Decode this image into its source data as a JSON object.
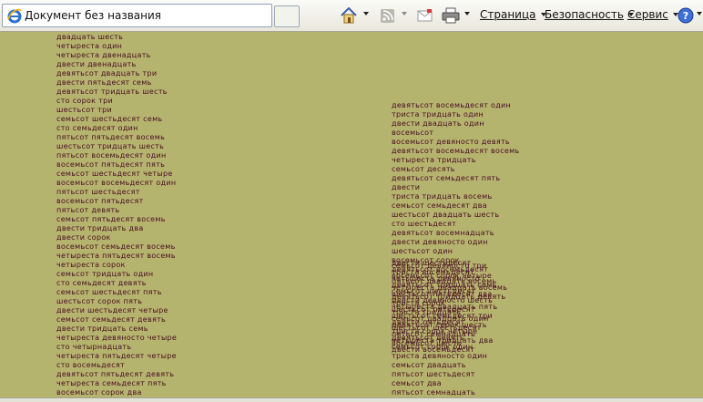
{
  "tab": {
    "title": "Документ без названия"
  },
  "toolbar": {
    "menus": [
      "Страница",
      "Безопасность",
      "Сервис"
    ],
    "icons": [
      "home-icon",
      "feeds-icon",
      "read-mail-icon",
      "print-icon",
      "help-icon"
    ]
  },
  "content": {
    "col1": [
      "двадцать шесть",
      "четыреста один",
      "четыреста двенадцать",
      "двести двенадцать",
      "девятьсот двадцать три",
      "двести пятьдесят семь",
      "девятьсот тридцать шесть",
      "сто сорок три",
      "шестьсот три",
      "семьсот шестьдесят семь",
      "сто семьдесят один",
      "пятьсот пятьдесят восемь",
      "шестьсот тридцать шесть",
      "пятьсот восемьдесят один",
      "восемьсот пятьдесят пять",
      "семьсот шестьдесят четыре",
      "восемьсот восемьдесят один",
      "пятьсот шестьдесят",
      "восемьсот пятьдесят",
      "пятьсот девять",
      "семьсот пятьдесят восемь",
      "двести тридцать два",
      "двести сорок",
      "восемьсот семьдесят восемь",
      "четыреста пятьдесят восемь",
      "четыреста сорок",
      "семьсот тридцать один",
      "сто семьдесят девять",
      "семьсот шестьдесят пять",
      "шестьсот сорок пять",
      "двести шестьдесят четыре",
      "семьсот семьдесят девять",
      "двести тридцать семь",
      "четыреста девяносто четыре",
      "сто четырнадцать",
      "четыреста пятьдесят четыре",
      "сто восемьдесят",
      "девятьсот пятьдесят девять",
      "четыреста семьдесят пять",
      "восемьсот сорок два"
    ],
    "col2": [
      "девятьсот восемьдесят один",
      "триста тридцать один",
      "двести двадцать один",
      "восемьсот",
      "восемьсот девяносто девять",
      "девятьсот восемьдесят восемь",
      "четыреста тридцать",
      "семьсот десять",
      "девятьсот семьдесят пять",
      "двести",
      "триста тридцать восемь",
      "семьсот семьдесят два",
      "шестьсот двадцать шесть",
      "сто шестьдесят",
      "девятьсот восемнадцать",
      "двести девяносто один",
      "шестьсот один",
      "восемьсот сорок"
    ],
    "col2_overlap": [
      "двести шестьдесят",
      "семьсот девяносто три",
      "девятьсот восемьдесят",
      "триста восемьдесят",
      "восемьсот сорок четыре",
      "четыреста девяносто",
      "пятьсот двадцать восемь",
      "девятьсот тридцать семь",
      "четыреста двадцать восемь",
      "семьсот шестьдесят",
      "шестьсот пятьдесят два",
      "девятьсот тридцать девять",
      "двести девяносто шесть",
      "триста сорок",
      "четыреста двадцать пять",
      "шестьсот пятьдесят",
      "триста тридцать",
      "шестьсот семьдесят три",
      "семьсот двадцать один",
      "двести пятьдесят",
      "девятьсот сорок шесть",
      "шестьсот шестьдесят",
      "триста сорок четыре",
      "пятьсот семнадцать",
      "девятьсот девять",
      "четыреста тридцать два",
      "восемьсот шесть",
      "семьсот сорок один",
      "двести восемьдесят"
    ],
    "col2_tail": [
      "триста девяносто один",
      "семьсот двадцать",
      "пятьсот шестьдесят",
      "семьсот два",
      "пятьсот семнадцать"
    ]
  }
}
